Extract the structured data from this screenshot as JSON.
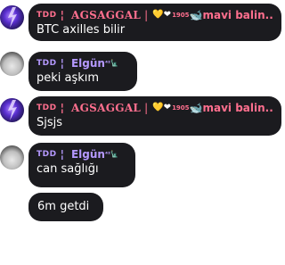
{
  "messages": [
    {
      "sender": {
        "prefix": "TDD",
        "sep": "¦",
        "name": "AGSAGGAL",
        "sep2": "|",
        "emoji": "💛❤",
        "num": "1905",
        "extra": "🐋mavi balin..."
      },
      "text": "BTC axilles bilir"
    },
    {
      "sender": {
        "prefix": "TDD",
        "sep": "¦",
        "name": "Elgün",
        "sup": "⁴²",
        "sup_icon": "🗽"
      },
      "text": "peki aşkım"
    },
    {
      "sender": {
        "prefix": "TDD",
        "sep": "¦",
        "name": "AGSAGGAL",
        "sep2": "|",
        "emoji": "💛❤",
        "num": "1905",
        "extra": "🐋mavi balin..."
      },
      "text": "Sjsjs"
    },
    {
      "sender": {
        "prefix": "TDD",
        "sep": "¦",
        "name": "Elgün",
        "sup": "⁴²",
        "sup_icon": "🗽"
      },
      "text": "can sağlığı"
    },
    {
      "text": "6m getdi"
    }
  ],
  "colors": {
    "bubble": "#1b1b1f",
    "agsaggal": "#ff6f8e",
    "elgun": "#b599ff",
    "text": "#ffffff"
  }
}
